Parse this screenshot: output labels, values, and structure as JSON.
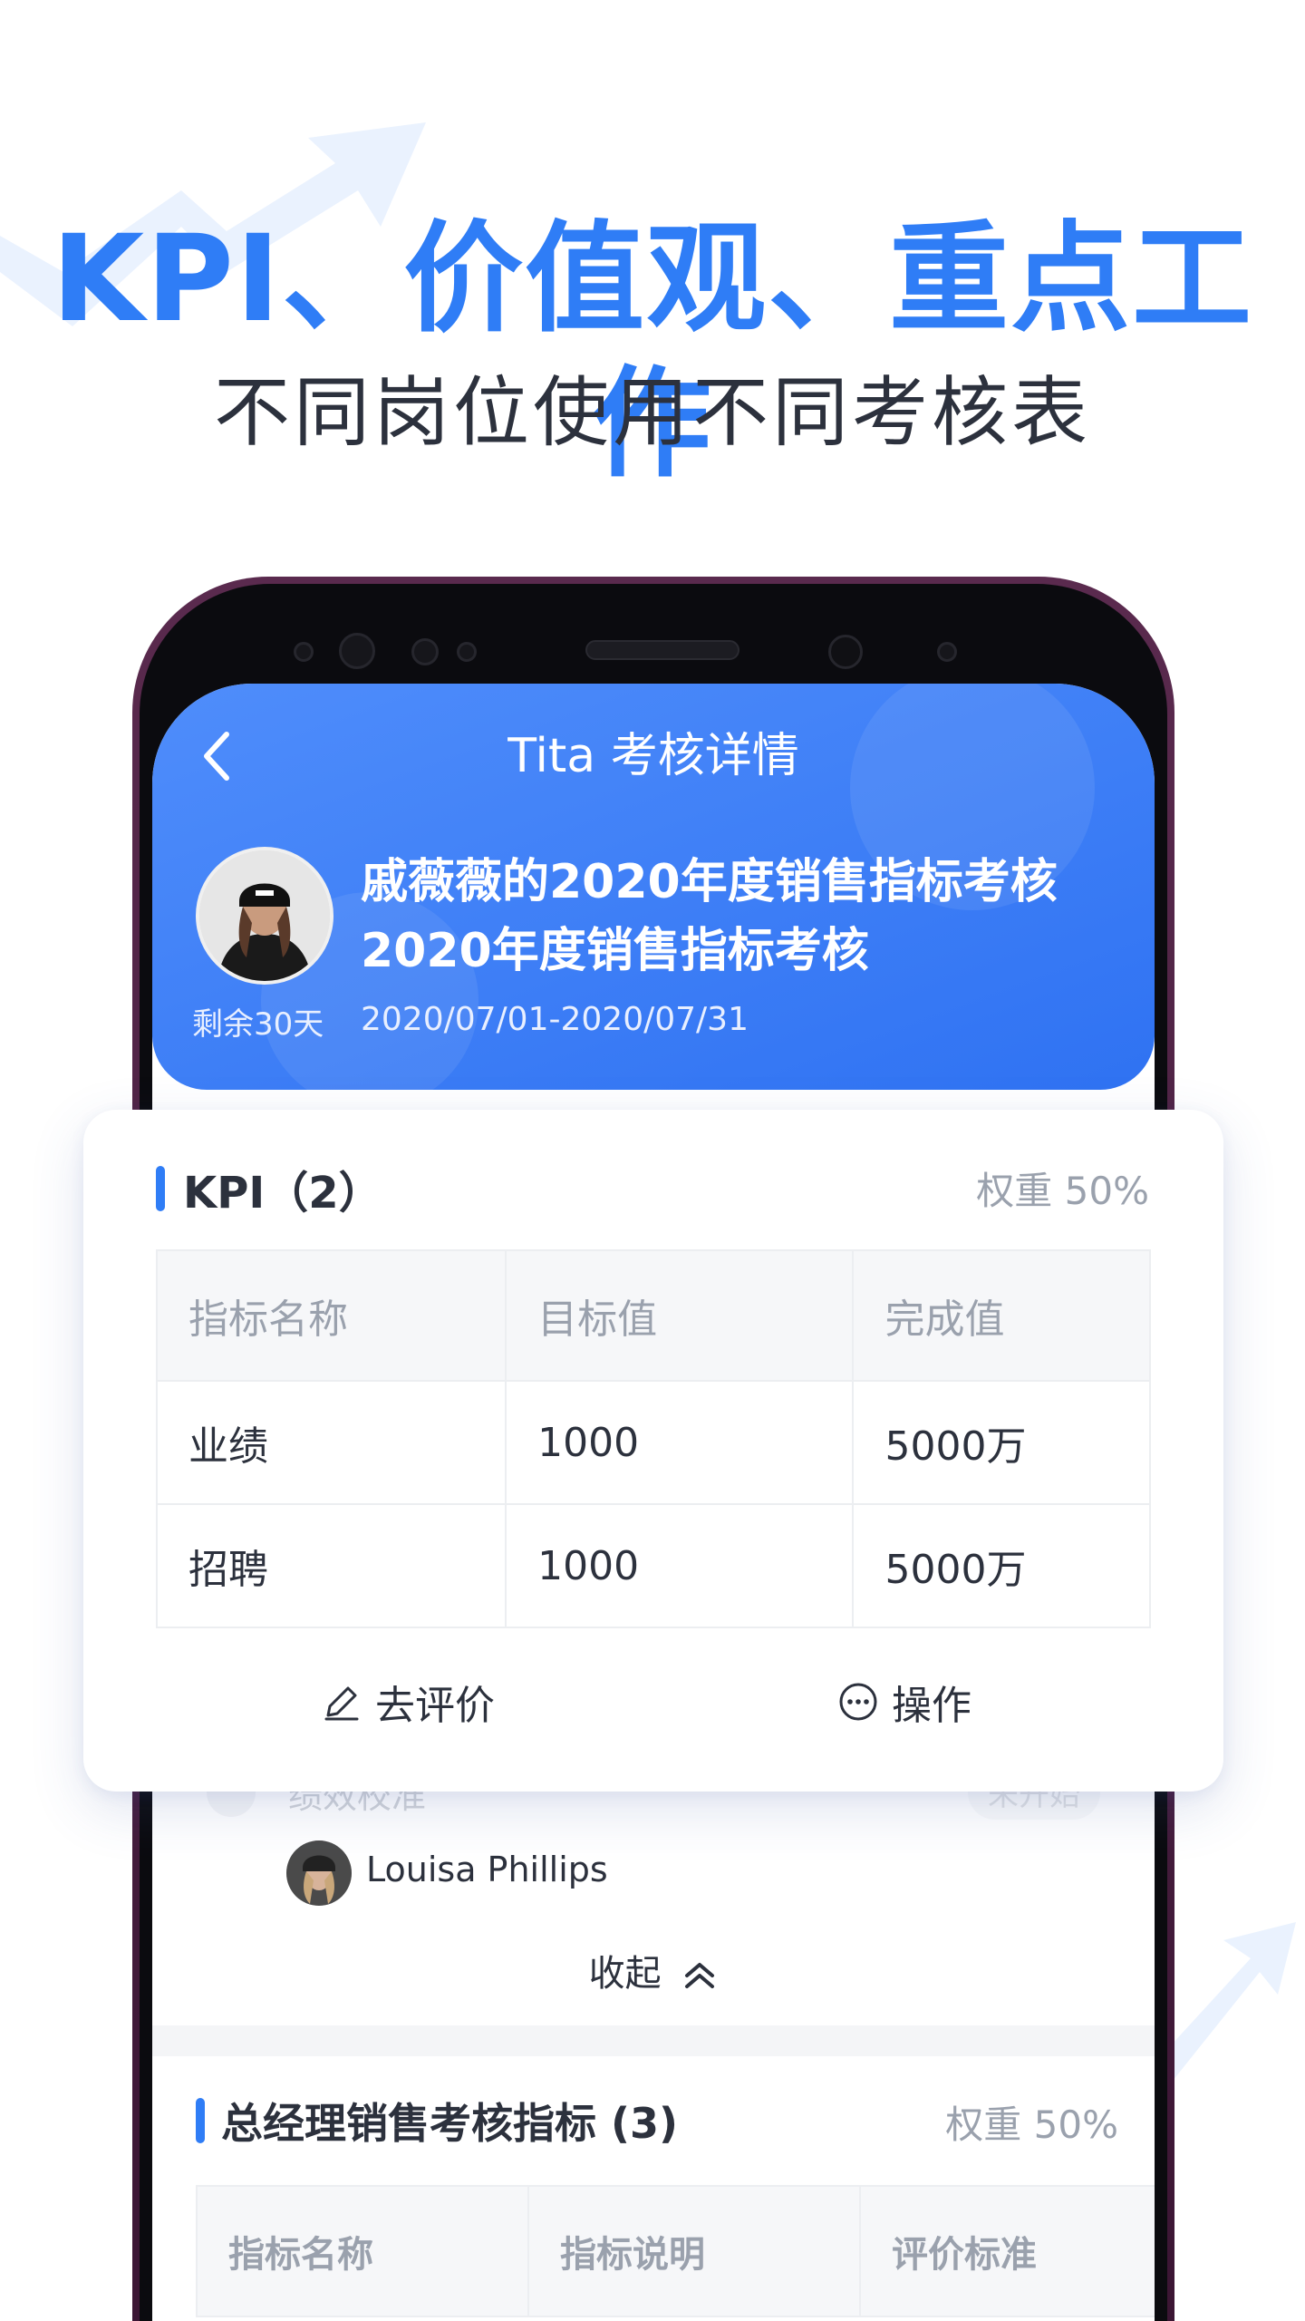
{
  "hero": {
    "title": "KPI、价值观、重点工作",
    "subtitle": "不同岗位使用不同考核表"
  },
  "app": {
    "nav_title": "Tita 考核详情",
    "review": {
      "title": "戚薇薇的2020年度销售指标考核",
      "subtitle": "2020年度销售指标考核",
      "remaining": "剩余30天",
      "period": "2020/07/01-2020/07/31"
    }
  },
  "kpi_card": {
    "title": "KPI（2）",
    "weight": "权重 50%",
    "columns": [
      "指标名称",
      "目标值",
      "完成值"
    ],
    "rows": [
      [
        "业绩",
        "1000",
        "5000万"
      ],
      [
        "招聘",
        "1000",
        "5000万"
      ]
    ],
    "actions": {
      "evaluate": "去评价",
      "operate": "操作"
    }
  },
  "underlay": {
    "step_label": "绩效校准",
    "step_status": "未开始",
    "user_name": "Louisa Phillips",
    "collapse_label": "收起"
  },
  "section2": {
    "title": "总经理销售考核指标 (3)",
    "weight": "权重 50%",
    "columns": [
      "指标名称",
      "指标说明",
      "评价标准"
    ]
  },
  "colors": {
    "accent": "#2f7df6",
    "header_gradient_start": "#4f8dfb",
    "header_gradient_end": "#2f72f2",
    "text_primary": "#2c313d",
    "text_muted": "#9aa1ad"
  },
  "icons": {
    "back": "chevron-left-icon",
    "evaluate": "pencil-icon",
    "operate": "more-circle-icon",
    "collapse": "double-chevron-up-icon"
  }
}
